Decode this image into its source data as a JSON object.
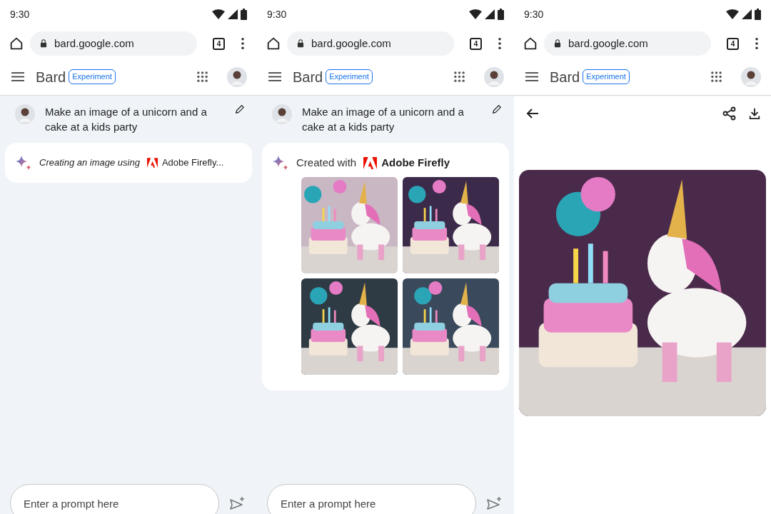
{
  "panels": [
    {
      "status_bar": {
        "time": "9:30"
      },
      "browser": {
        "url": "bard.google.com",
        "tab_count": "4"
      },
      "app_bar": {
        "title": "Bard",
        "badge": "Experiment"
      },
      "prompt": "Make an image of a unicorn and a cake at a kids party",
      "response": {
        "kind": "loading",
        "lead": "Creating an image using",
        "brand": "Adobe Firefly..."
      },
      "input": {
        "placeholder": "Enter a prompt here"
      }
    },
    {
      "status_bar": {
        "time": "9:30"
      },
      "browser": {
        "url": "bard.google.com",
        "tab_count": "4"
      },
      "app_bar": {
        "title": "Bard",
        "badge": "Experiment"
      },
      "prompt": "Make an image of a unicorn and a cake at a kids party",
      "response": {
        "kind": "result",
        "lead": "Created with",
        "brand": "Adobe Firefly"
      },
      "input": {
        "placeholder": "Enter a prompt here"
      }
    },
    {
      "status_bar": {
        "time": "9:30"
      },
      "browser": {
        "url": "bard.google.com",
        "tab_count": "4"
      },
      "app_bar": {
        "title": "Bard",
        "badge": "Experiment"
      }
    }
  ]
}
